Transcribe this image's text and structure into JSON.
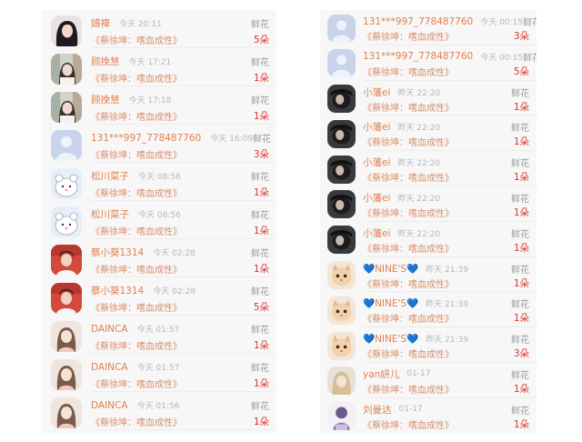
{
  "left_panel": {
    "rows": [
      {
        "avatar": "girl-black-hair",
        "name": "婧禕",
        "time": "今天 20:11",
        "gift": "鲜花",
        "song": "《蔡徐坤：嗜血成性》",
        "count": "5朵"
      },
      {
        "avatar": "girl-bookshelf",
        "name": "顾挽慧",
        "time": "今天 17:21",
        "gift": "鲜花",
        "song": "《蔡徐坤：嗜血成性》",
        "count": "1朵"
      },
      {
        "avatar": "girl-bookshelf",
        "name": "顾挽慧",
        "time": "今天 17:18",
        "gift": "鲜花",
        "song": "《蔡徐坤：嗜血成性》",
        "count": "1朵"
      },
      {
        "avatar": "default-user",
        "name": "131***997_778487760",
        "time": "今天 16:09",
        "gift": "鲜花",
        "song": "《蔡徐坤：嗜血成性》",
        "count": "3朵"
      },
      {
        "avatar": "cartoon-animal",
        "name": "松川菜子",
        "time": "今天 08:56",
        "gift": "鲜花",
        "song": "《蔡徐坤：嗜血成性》",
        "count": "1朵"
      },
      {
        "avatar": "cartoon-animal",
        "name": "松川菜子",
        "time": "今天 08:56",
        "gift": "鲜花",
        "song": "《蔡徐坤：嗜血成性》",
        "count": "1朵"
      },
      {
        "avatar": "boy-red",
        "name": "蔡小葵1314",
        "time": "今天 02:28",
        "gift": "鲜花",
        "song": "《蔡徐坤：嗜血成性》",
        "count": "1朵"
      },
      {
        "avatar": "boy-red",
        "name": "蔡小葵1314",
        "time": "今天 02:28",
        "gift": "鲜花",
        "song": "《蔡徐坤：嗜血成性》",
        "count": "5朵"
      },
      {
        "avatar": "girl-light",
        "name": "DAINCA",
        "time": "今天 01:57",
        "gift": "鲜花",
        "song": "《蔡徐坤：嗜血成性》",
        "count": "1朵"
      },
      {
        "avatar": "girl-light",
        "name": "DAINCA",
        "time": "今天 01:57",
        "gift": "鲜花",
        "song": "《蔡徐坤：嗜血成性》",
        "count": "1朵"
      },
      {
        "avatar": "girl-light",
        "name": "DAINCA",
        "time": "今天 01:56",
        "gift": "鲜花",
        "song": "《蔡徐坤：嗜血成性》",
        "count": "1朵"
      }
    ]
  },
  "right_panel": {
    "rows": [
      {
        "avatar": "default-user",
        "name": "131***997_778487760",
        "time": "今天 00:15",
        "gift": "鲜花",
        "song": "《蔡徐坤：嗜血成性》",
        "count": "3朵"
      },
      {
        "avatar": "default-user",
        "name": "131***997_778487760",
        "time": "今天 00:15",
        "gift": "鲜花",
        "song": "《蔡徐坤：嗜血成性》",
        "count": "5朵"
      },
      {
        "avatar": "dark-photo",
        "name": "小藩ei",
        "time": "昨天 22:20",
        "gift": "鲜花",
        "song": "《蔡徐坤：嗜血成性》",
        "count": "1朵"
      },
      {
        "avatar": "dark-photo",
        "name": "小藩ei",
        "time": "昨天 22:20",
        "gift": "鲜花",
        "song": "《蔡徐坤：嗜血成性》",
        "count": "1朵"
      },
      {
        "avatar": "dark-photo",
        "name": "小藩ei",
        "time": "昨天 22:20",
        "gift": "鲜花",
        "song": "《蔡徐坤：嗜血成性》",
        "count": "1朵"
      },
      {
        "avatar": "dark-photo",
        "name": "小藩ei",
        "time": "昨天 22:20",
        "gift": "鲜花",
        "song": "《蔡徐坤：嗜血成性》",
        "count": "1朵"
      },
      {
        "avatar": "dark-photo",
        "name": "小藩ei",
        "time": "昨天 22:20",
        "gift": "鲜花",
        "song": "《蔡徐坤：嗜血成性》",
        "count": "1朵"
      },
      {
        "avatar": "cat-photo",
        "name": "💙NINE'S💙",
        "time": "昨天 21:39",
        "gift": "鲜花",
        "song": "《蔡徐坤：嗜血成性》",
        "count": "1朵"
      },
      {
        "avatar": "cat-photo",
        "name": "💙NINE'S💙",
        "time": "昨天 21:39",
        "gift": "鲜花",
        "song": "《蔡徐坤：嗜血成性》",
        "count": "1朵"
      },
      {
        "avatar": "cat-photo",
        "name": "💙NINE'S💙",
        "time": "昨天 21:39",
        "gift": "鲜花",
        "song": "《蔡徐坤：嗜血成性》",
        "count": "3朵"
      },
      {
        "avatar": "girl-blonde",
        "name": "yan妍儿",
        "time": "01-17",
        "gift": "鲜花",
        "song": "《蔡徐坤：嗜血成性》",
        "count": "1朵"
      },
      {
        "avatar": "purple-figure",
        "name": "刘曼达",
        "time": "01-17",
        "gift": "鲜花",
        "song": "《蔡徐坤：嗜血成性》",
        "count": "1朵"
      }
    ]
  },
  "colors": {
    "name": "#e0814f",
    "count": "#d6362b",
    "song": "#d8906a",
    "time": "#b7b7b7",
    "gift_label": "#9c9c9c",
    "panel_bg": "#f7f7f7"
  }
}
